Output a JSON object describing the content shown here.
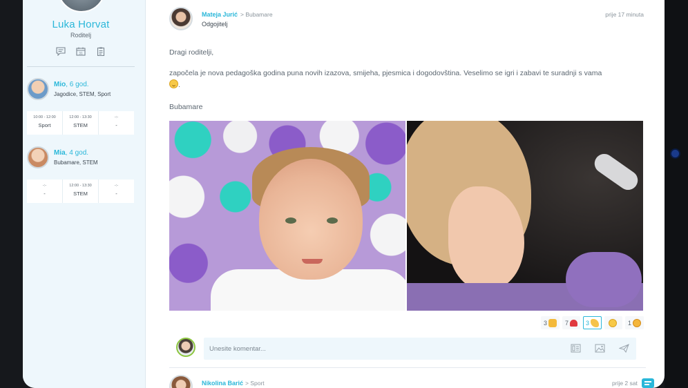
{
  "profile": {
    "name": "Luka Horvat",
    "role": "Roditelj",
    "actions": [
      "chat-icon",
      "calendar-icon",
      "clipboard-icon"
    ]
  },
  "children": [
    {
      "name": "Mio",
      "age": ", 6 god.",
      "groups": "Jagodice, STEM, Sport",
      "schedule": [
        {
          "time": "10:00 - 12:00",
          "activity": "Sport"
        },
        {
          "time": "12:00 - 13:30",
          "activity": "STEM"
        },
        {
          "time": "-:-",
          "activity": "-"
        }
      ]
    },
    {
      "name": "Mia",
      "age": ", 4 god.",
      "groups": "Bubamare, STEM",
      "schedule": [
        {
          "time": "-:-",
          "activity": "-"
        },
        {
          "time": "12:00 - 13:30",
          "activity": "STEM"
        },
        {
          "time": "-:-",
          "activity": "-"
        }
      ]
    }
  ],
  "post": {
    "author": "Mateja Jurić",
    "separator": "> Bubamare",
    "author_role": "Odgojitelj",
    "time": "prije 17 minuta",
    "greeting": "Dragi roditelji,",
    "body": "započela je nova pedagoška godina puna novih izazova, smijeha, pjesmica i dogodovština. Veselimo se igri i zabavi te suradnji s vama",
    "body_end": ".",
    "signature": "Bubamare",
    "reactions": [
      {
        "count": "3",
        "icon": "thumbs-up-icon",
        "active": false
      },
      {
        "count": "7",
        "icon": "heart-icon",
        "active": false
      },
      {
        "count": "3",
        "icon": "clapping-hands-icon",
        "active": true
      },
      {
        "count": "",
        "icon": "laughing-face-icon",
        "active": false
      },
      {
        "count": "1",
        "icon": "party-face-icon",
        "active": false
      }
    ],
    "comment_placeholder": "Unesite komentar...",
    "comment_tools": [
      "attachment-icon",
      "image-icon",
      "send-icon"
    ]
  },
  "next_post": {
    "author": "Nikolina Barić",
    "separator": "> Sport",
    "time": "prije 2 sat"
  },
  "colors": {
    "accent": "#2ab7d9",
    "sidebar_bg": "#eef7fc",
    "text": "#5b6670"
  }
}
